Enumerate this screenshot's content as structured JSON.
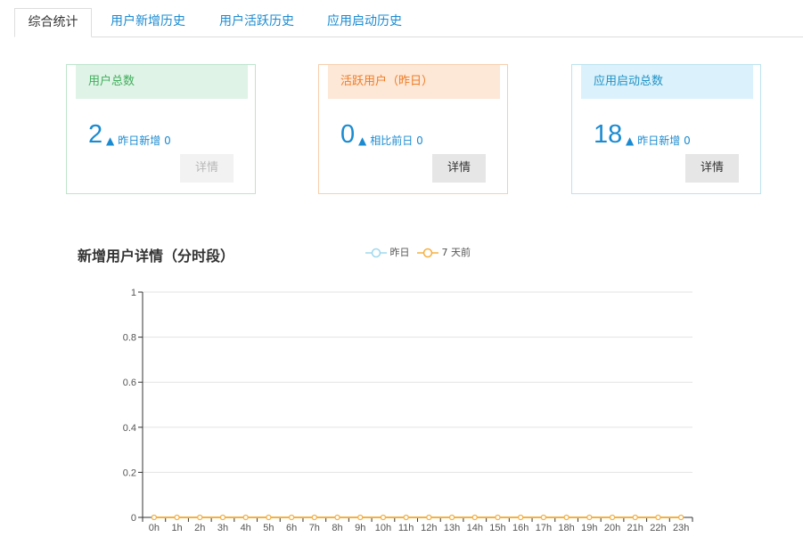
{
  "tabs": [
    {
      "label": "综合统计",
      "active": true
    },
    {
      "label": "用户新增历史",
      "active": false
    },
    {
      "label": "用户活跃历史",
      "active": false
    },
    {
      "label": "应用启动历史",
      "active": false
    }
  ],
  "cards": [
    {
      "title": "用户总数",
      "value": "2",
      "trend_icon": "up-triangle-icon",
      "trend_label": "昨日新增",
      "trend_value": "0",
      "button": "详情",
      "button_disabled": true
    },
    {
      "title": "活跃用户（昨日）",
      "value": "0",
      "trend_icon": "up-triangle-icon",
      "trend_label": "相比前日",
      "trend_value": "0",
      "button": "详情",
      "button_disabled": false
    },
    {
      "title": "应用启动总数",
      "value": "18",
      "trend_icon": "up-triangle-icon",
      "trend_label": "昨日新增",
      "trend_value": "0",
      "button": "详情",
      "button_disabled": false
    }
  ],
  "chart": {
    "title": "新增用户详情（分时段）",
    "legend": [
      {
        "label": "昨日",
        "color": "#9fd8ee"
      },
      {
        "label": "7 天前",
        "color": "#f5b041"
      }
    ]
  },
  "chart_data": {
    "type": "line",
    "title": "新增用户详情（分时段）",
    "categories": [
      "0h",
      "1h",
      "2h",
      "3h",
      "4h",
      "5h",
      "6h",
      "7h",
      "8h",
      "9h",
      "10h",
      "11h",
      "12h",
      "13h",
      "14h",
      "15h",
      "16h",
      "17h",
      "18h",
      "19h",
      "20h",
      "21h",
      "22h",
      "23h"
    ],
    "series": [
      {
        "name": "昨日",
        "color": "#9fd8ee",
        "values": [
          0,
          0,
          0,
          0,
          0,
          0,
          0,
          0,
          0,
          0,
          0,
          0,
          0,
          0,
          0,
          0,
          0,
          0,
          0,
          0,
          0,
          0,
          0,
          0
        ]
      },
      {
        "name": "7 天前",
        "color": "#f5b041",
        "values": [
          0,
          0,
          0,
          0,
          0,
          0,
          0,
          0,
          0,
          0,
          0,
          0,
          0,
          0,
          0,
          0,
          0,
          0,
          0,
          0,
          0,
          0,
          0,
          0
        ]
      }
    ],
    "yticks": [
      "0",
      "0.2",
      "0.4",
      "0.6",
      "0.8",
      "1"
    ],
    "ylim": [
      0,
      1
    ],
    "grid": true,
    "legend_position": "top-center"
  }
}
